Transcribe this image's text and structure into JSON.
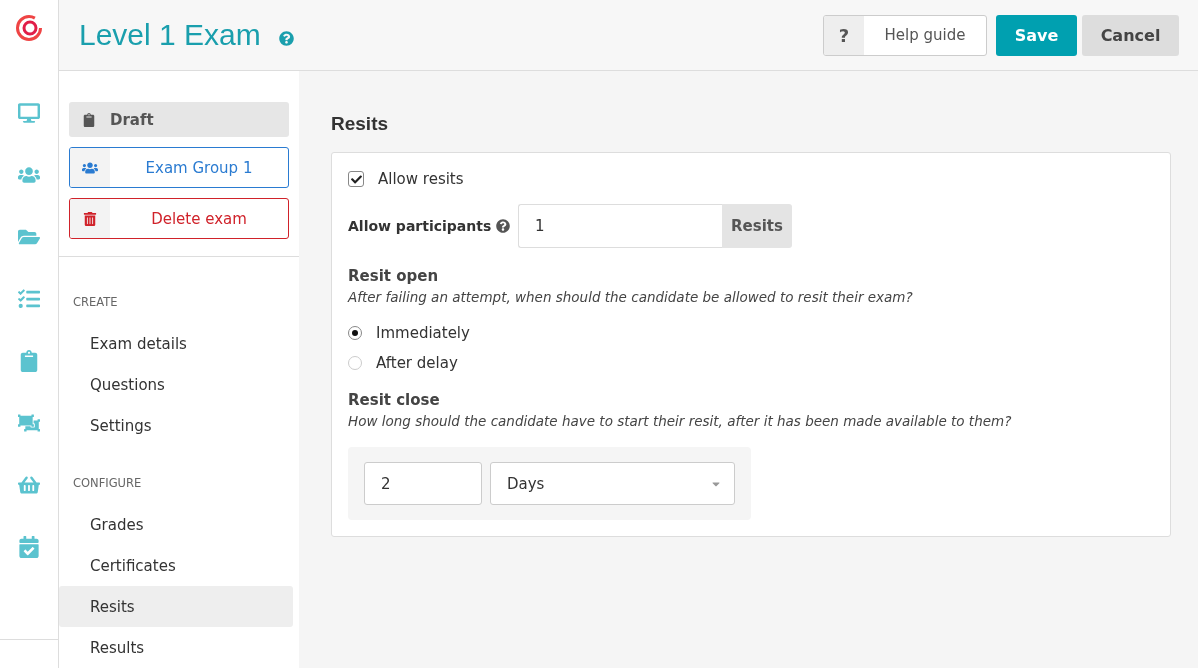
{
  "header": {
    "title": "Level 1 Exam",
    "help_button": "?",
    "buttons": [
      {
        "label": "Help guide",
        "kind": "help"
      },
      {
        "label": "Save",
        "kind": "primary"
      },
      {
        "label": "Cancel",
        "kind": "secondary"
      }
    ]
  },
  "sidebar": {
    "status": "Draft",
    "actions": [
      {
        "label": "Exam Group 1",
        "kind": "group"
      },
      {
        "label": "Delete exam",
        "kind": "delete"
      }
    ],
    "sections": [
      {
        "heading": "CREATE",
        "items": [
          {
            "label": "Exam details",
            "selected": false
          },
          {
            "label": "Questions",
            "selected": false
          },
          {
            "label": "Settings",
            "selected": false
          }
        ]
      },
      {
        "heading": "CONFIGURE",
        "items": [
          {
            "label": "Grades",
            "selected": false
          },
          {
            "label": "Certificates",
            "selected": false
          },
          {
            "label": "Resits",
            "selected": true
          },
          {
            "label": "Results",
            "selected": false
          }
        ]
      }
    ]
  },
  "content": {
    "title": "Resits",
    "allow_resits": {
      "label": "Allow resits",
      "checked": true
    },
    "participants": {
      "label": "Allow participants",
      "value": "1",
      "addon": "Resits"
    },
    "resit_open": {
      "heading": "Resit open",
      "description": "After failing an attempt, when should the candidate be allowed to resit their exam?",
      "options": [
        {
          "label": "Immediately",
          "selected": true
        },
        {
          "label": "After delay",
          "selected": false
        }
      ]
    },
    "resit_close": {
      "heading": "Resit close",
      "description": "How long should the candidate have to start their resit, after it has been made available to them?",
      "amount": "2",
      "unit": "Days"
    }
  }
}
